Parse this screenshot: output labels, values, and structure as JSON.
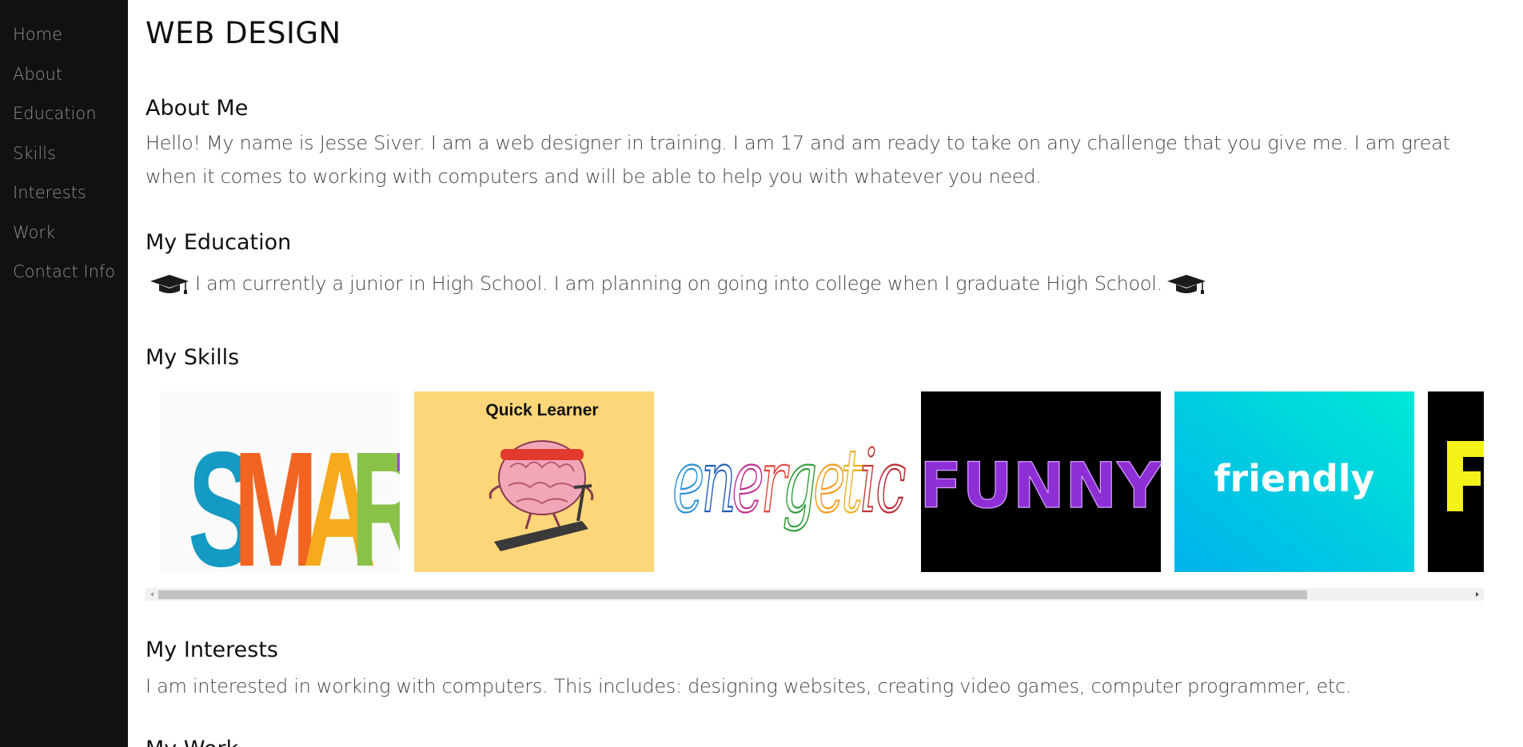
{
  "sidebar": {
    "items": [
      {
        "label": "Home"
      },
      {
        "label": "About"
      },
      {
        "label": "Education"
      },
      {
        "label": "Skills"
      },
      {
        "label": "Interests"
      },
      {
        "label": "Work"
      },
      {
        "label": "Contact Info"
      }
    ]
  },
  "main": {
    "title": "WEB DESIGN",
    "about": {
      "heading": "About Me",
      "text": "Hello! My name is Jesse Siver. I am a web designer in training. I am 17 and am ready to take on any challenge that you give me. I am great when it comes to working with computers and will be able to help you with whatever you need."
    },
    "education": {
      "heading": "My Education",
      "text": "I am currently a junior in High School. I am planning on going into college when I graduate High School."
    },
    "skills": {
      "heading": "My Skills",
      "cards": [
        {
          "label": "SMART",
          "icon": "smart-word-image"
        },
        {
          "label": "Quick Learner",
          "icon": "brain-treadmill-image"
        },
        {
          "label": "energetic",
          "icon": "energetic-word-image"
        },
        {
          "label": "FUNNY",
          "icon": "funny-word-image"
        },
        {
          "label": "friendly",
          "icon": "friendly-word-image"
        }
      ],
      "scroll_position": 0.0
    },
    "interests": {
      "heading": "My Interests",
      "text": "I am interested in working with computers. This includes: designing websites, creating video games, computer programmer, etc."
    },
    "work": {
      "heading": "My Work"
    }
  },
  "colors": {
    "sidebar_bg": "#111111",
    "sidebar_text": "#8e8e8e",
    "quick_learner_bg": "#fcd679",
    "funny_purple": "#8e2fd6",
    "friendly_gradient_start": "#00b2ec",
    "friendly_gradient_end": "#00e8d6"
  }
}
